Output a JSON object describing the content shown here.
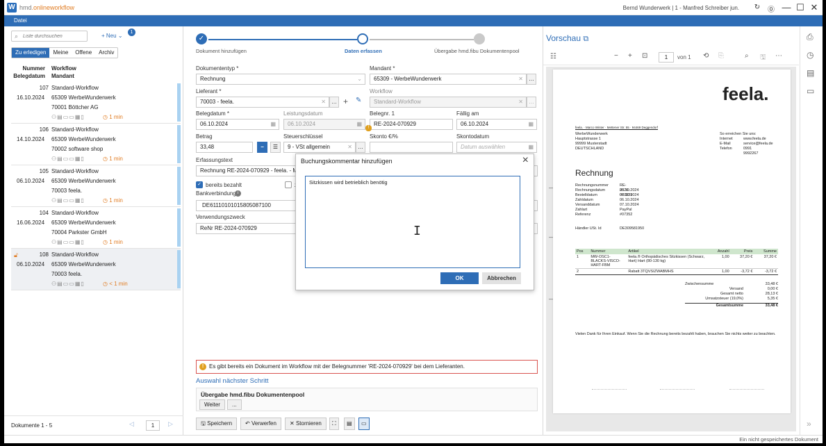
{
  "titlebar": {
    "brand_prefix": "hmd",
    "brand_suffix": ".onlineworkflow",
    "user": "Bernd Wunderwerk | 1 - Manfred Schreiber jun.",
    "menu": "Datei"
  },
  "left": {
    "search_placeholder": "Liste durchsuchen",
    "new_label": "+ Neu",
    "new_badge": "1",
    "tabs": [
      "Zu erledigen",
      "Meine",
      "Offene",
      "Archiv"
    ],
    "col1": [
      "Nummer",
      "Belegdatum"
    ],
    "col2": [
      "Workflow",
      "Mandant"
    ],
    "rows": [
      {
        "num": "107",
        "date": "16.10.2024",
        "workflow": "Standard-Workflow",
        "mandant": "65309  WerbeWunderwerk",
        "lieferant": "70001  Böttcher AG",
        "time": "1 min"
      },
      {
        "num": "106",
        "date": "14.10.2024",
        "workflow": "Standard-Workflow",
        "mandant": "65309  WerbeWunderwerk",
        "lieferant": "70002  software shop",
        "time": "1 min"
      },
      {
        "num": "105",
        "date": "06.10.2024",
        "workflow": "Standard-Workflow",
        "mandant": "65309  WerbeWunderwerk",
        "lieferant": "70003  feela.",
        "time": "1 min"
      },
      {
        "num": "104",
        "date": "16.06.2024",
        "workflow": "Standard-Workflow",
        "mandant": "65309  WerbeWunderwerk",
        "lieferant": "70004  Parkster GmbH",
        "time": "1 min"
      },
      {
        "num": "108",
        "date": "06.10.2024",
        "workflow": "Standard-Workflow",
        "mandant": "65309  WerbeWunderwerk",
        "lieferant": "70003  feela.",
        "time": "< 1 min"
      }
    ],
    "footer_count": "Dokumente 1 - 5",
    "page": "1"
  },
  "steps": [
    "Dokument hinzufügen",
    "Daten erfassen",
    "Übergabe hmd.fibu Dokumentenpool"
  ],
  "form": {
    "dokumententyp_label": "Dokumententyp *",
    "dokumententyp": "Rechnung",
    "mandant_label": "Mandant *",
    "mandant": "65309 - WerbeWunderwerk",
    "lieferant_label": "Lieferant *",
    "lieferant": "70003 - feela.",
    "workflow_label": "Workflow",
    "workflow": "Standard-Workflow",
    "belegdatum_label": "Belegdatum *",
    "belegdatum": "06.10.2024",
    "leistungsdatum_label": "Leistungsdatum",
    "leistungsdatum": "06.10.2024",
    "belegnr_label": "Belegnr. 1",
    "belegnr": "RE-2024-070929",
    "faellig_label": "Fällig am",
    "faellig": "06.10.2024",
    "betrag_label": "Betrag",
    "betrag": "33,48",
    "steuer_label": "Steuerschlüssel",
    "steuer": "9 - VSt allgemein",
    "skonto_label": "Skonto €/%",
    "skontodatum_label": "Skontodatum",
    "skontodatum_placeholder": "Datum auswählen",
    "erfassung_label": "Erfassungstext",
    "erfassung": "Rechnung RE-2024-070929 - feela. - Marco V",
    "bezahlt_label": "bereits bezahlt",
    "zu_label": "zu",
    "bank_label": "Bankverbindung",
    "iban": "DE61110101015805087100",
    "verwendung_label": "Verwendungszweck",
    "verwendung": "ReNr RE-2024-070929"
  },
  "warning": "Es gibt bereits ein Dokument im Workflow mit der Belegnummer 'RE-2024-070929' bei dem Lieferanten.",
  "nextstep": {
    "title": "Auswahl nächster Schritt",
    "box_title": "Übergabe hmd.fibu Dokumentenpool",
    "weiter": "Weiter",
    "more": "..."
  },
  "bottom_buttons": [
    "Speichern",
    "Verwerfen",
    "Stornieren"
  ],
  "dialog": {
    "title": "Buchungskommentar hinzufügen",
    "text": "Sitzkissen wird betrieblich benötig",
    "ok": "OK",
    "cancel": "Abbrechen"
  },
  "preview": {
    "title": "Vorschau",
    "page": "1",
    "of": "von 1",
    "doc": {
      "logo": "feela.",
      "sender_line": "feela. · Marco Winter · Mettener Str. 55 · 94469 Deggendorf",
      "addr": [
        "WerbeWunderwerk",
        "Hauptstrasse 1",
        "99999 Musterstadt",
        "DEUTSCHLAND"
      ],
      "contact_title": "So erreichen Sie uns:",
      "contact": [
        [
          "Internet",
          "www.feela.de"
        ],
        [
          "E-Mail",
          "service@feela.de"
        ],
        [
          "Telefon",
          "0991 9992267"
        ]
      ],
      "heading": "Rechnung",
      "meta": [
        [
          "Rechnungsnummer",
          "RE-2024-070929"
        ],
        [
          "Rechnungsdatum",
          "06.10.2024"
        ],
        [
          "Bestelldatum",
          "06.10.2024"
        ],
        [
          "Zahldatum",
          "06.10.2024"
        ],
        [
          "Versanddatum",
          "07.10.2024"
        ],
        [
          "Zahlart",
          "PayPal"
        ],
        [
          "Referenz",
          "#07352"
        ]
      ],
      "ust_label": "Händler USt. Id",
      "ust": "DE309581950",
      "table_head": [
        "Pos",
        "Nummer",
        "Artikel",
        "Anzahl",
        "Preis",
        "Summe"
      ],
      "items": [
        [
          "1",
          "MW-OSC1-BLACKS-VISCO-HART-FBM",
          "feela.® Orthopädisches Sitzkissen (Schwarz, Hart) Hart (80-130 kg)",
          "1,00",
          "37,20 €",
          "37,20 €"
        ],
        [
          "2",
          "",
          "Rabatt 3TQVSIZWABMHS",
          "1,00",
          "-3,72 €",
          "-3,72 €"
        ]
      ],
      "totals": [
        [
          "Zwischensumme",
          "33,48 €"
        ],
        [
          "Versand",
          "0,00 €"
        ],
        [
          "Gesamt netto",
          "28,13 €"
        ],
        [
          "Umsatzsteuer (19,0%)",
          "5,35 €"
        ],
        [
          "Gesamtsumme",
          "33,48 €"
        ]
      ],
      "thanks": "Vielen Dank für Ihren Einkauf. Wenn Sie die Rechnung bereits bezahlt haben, brauchen Sie nichts weiter zu beachten."
    }
  },
  "status": "Ein nicht gespeichertes Dokument"
}
